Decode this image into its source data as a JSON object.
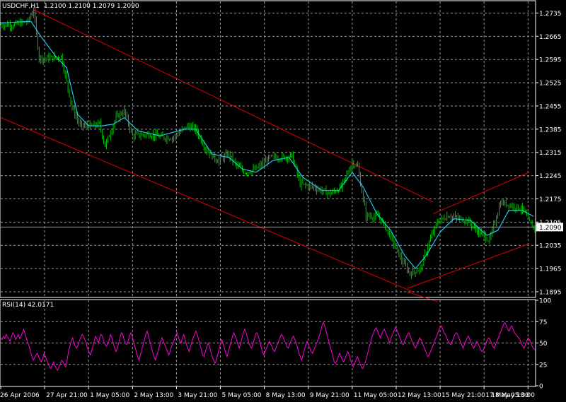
{
  "colors": {
    "background": "#000000",
    "axis": "#ffffff",
    "grid": "#9a9a9a",
    "candle": "#00c000",
    "ma": "#22c7e6",
    "channel": "#e00000",
    "rsi": "#ff00d8",
    "price_line": "#9aa0a6"
  },
  "header": {
    "symbol": "USDCHF,H1",
    "ohlc": "1.2100 1.2100 1.2079 1.2090"
  },
  "rsi_header": "RSI(14) 42.0171",
  "current_price_label": "1.2090",
  "chart_data": [
    {
      "type": "candlestick",
      "title": "USDCHF,H1",
      "ylim": [
        1.188,
        1.277
      ],
      "y_ticks": [
        "1.2735",
        "1.2665",
        "1.2595",
        "1.2525",
        "1.2455",
        "1.2385",
        "1.2315",
        "1.2245",
        "1.2175",
        "1.2105",
        "1.2035",
        "1.1965",
        "1.1895"
      ],
      "y_tick_values": [
        1.2735,
        1.2665,
        1.2595,
        1.2525,
        1.2455,
        1.2385,
        1.2315,
        1.2245,
        1.2175,
        1.2105,
        1.2035,
        1.1965,
        1.1895
      ],
      "x_ticks": [
        "26 Apr 2006",
        "27 Apr 21:00",
        "1 May 05:00",
        "2 May 13:00",
        "3 May 21:00",
        "5 May 05:00",
        "8 May 13:00",
        "9 May 21:00",
        "11 May 05:00",
        "12 May 13:00",
        "15 May 21:00",
        "17 May 05:00",
        "18 May 13:00"
      ],
      "x_tick_bars": [
        0,
        32,
        64,
        96,
        128,
        160,
        192,
        224,
        256,
        288,
        320,
        352,
        384
      ],
      "bar_count": 390,
      "current_price": 1.209,
      "close_path": [
        [
          0,
          1.27
        ],
        [
          10,
          1.27
        ],
        [
          20,
          1.271
        ],
        [
          24,
          1.2745
        ],
        [
          28,
          1.26
        ],
        [
          38,
          1.26
        ],
        [
          44,
          1.2605
        ],
        [
          52,
          1.245
        ],
        [
          58,
          1.2395
        ],
        [
          66,
          1.2395
        ],
        [
          72,
          1.24
        ],
        [
          76,
          1.2335
        ],
        [
          84,
          1.242
        ],
        [
          90,
          1.244
        ],
        [
          96,
          1.2365
        ],
        [
          108,
          1.237
        ],
        [
          118,
          1.236
        ],
        [
          126,
          1.236
        ],
        [
          136,
          1.2395
        ],
        [
          142,
          1.2385
        ],
        [
          150,
          1.232
        ],
        [
          158,
          1.229
        ],
        [
          166,
          1.231
        ],
        [
          172,
          1.2275
        ],
        [
          178,
          1.2255
        ],
        [
          186,
          1.2265
        ],
        [
          196,
          1.23
        ],
        [
          206,
          1.23
        ],
        [
          212,
          1.2305
        ],
        [
          218,
          1.222
        ],
        [
          228,
          1.221
        ],
        [
          240,
          1.219
        ],
        [
          248,
          1.221
        ],
        [
          256,
          1.2285
        ],
        [
          260,
          1.227
        ],
        [
          266,
          1.2125
        ],
        [
          276,
          1.212
        ],
        [
          284,
          1.206
        ],
        [
          292,
          1.199
        ],
        [
          298,
          1.195
        ],
        [
          306,
          1.1965
        ],
        [
          312,
          1.2045
        ],
        [
          318,
          1.2105
        ],
        [
          326,
          1.2125
        ],
        [
          334,
          1.2115
        ],
        [
          340,
          1.211
        ],
        [
          348,
          1.2075
        ],
        [
          356,
          1.205
        ],
        [
          364,
          1.2165
        ],
        [
          372,
          1.2155
        ],
        [
          380,
          1.2145
        ],
        [
          386,
          1.2095
        ],
        [
          389,
          1.209
        ]
      ],
      "ma_path": [
        [
          0,
          1.2705
        ],
        [
          22,
          1.271
        ],
        [
          30,
          1.266
        ],
        [
          40,
          1.2605
        ],
        [
          48,
          1.257
        ],
        [
          56,
          1.243
        ],
        [
          64,
          1.2395
        ],
        [
          74,
          1.2395
        ],
        [
          82,
          1.24
        ],
        [
          90,
          1.242
        ],
        [
          100,
          1.238
        ],
        [
          116,
          1.2365
        ],
        [
          134,
          1.2385
        ],
        [
          142,
          1.2385
        ],
        [
          154,
          1.231
        ],
        [
          166,
          1.23
        ],
        [
          176,
          1.2265
        ],
        [
          186,
          1.2255
        ],
        [
          198,
          1.229
        ],
        [
          210,
          1.23
        ],
        [
          220,
          1.224
        ],
        [
          234,
          1.22
        ],
        [
          246,
          1.22
        ],
        [
          256,
          1.2255
        ],
        [
          264,
          1.221
        ],
        [
          274,
          1.213
        ],
        [
          284,
          1.208
        ],
        [
          294,
          1.2005
        ],
        [
          302,
          1.1965
        ],
        [
          310,
          1.2005
        ],
        [
          320,
          1.2075
        ],
        [
          330,
          1.2115
        ],
        [
          342,
          1.211
        ],
        [
          354,
          1.2065
        ],
        [
          362,
          1.208
        ],
        [
          370,
          1.214
        ],
        [
          380,
          1.214
        ],
        [
          389,
          1.212
        ]
      ],
      "channel_lines": [
        [
          [
            24,
            1.2745
          ],
          [
            315,
            1.2165
          ]
        ],
        [
          [
            0,
            1.242
          ],
          [
            300,
            1.1895
          ]
        ],
        [
          [
            296,
            1.1905
          ],
          [
            385,
            1.204
          ]
        ],
        [
          [
            315,
            1.213
          ],
          [
            385,
            1.2255
          ]
        ],
        [
          [
            296,
            1.1895
          ],
          [
            318,
            1.1865
          ]
        ]
      ]
    },
    {
      "type": "line",
      "title": "RSI(14) 42.0171",
      "ylim": [
        0,
        100
      ],
      "y_ticks": [
        "100",
        "75",
        "50",
        "25",
        "0"
      ],
      "y_tick_values": [
        100,
        75,
        50,
        25,
        0
      ],
      "values": [
        56,
        54,
        58,
        55,
        60,
        57,
        55,
        52,
        58,
        62,
        59,
        54,
        57,
        60,
        55,
        58,
        62,
        66,
        60,
        55,
        50,
        46,
        40,
        34,
        30,
        33,
        36,
        38,
        34,
        30,
        28,
        32,
        38,
        34,
        30,
        26,
        22,
        20,
        24,
        28,
        24,
        20,
        18,
        22,
        26,
        30,
        28,
        24,
        22,
        30,
        40,
        46,
        52,
        56,
        50,
        46,
        44,
        48,
        52,
        56,
        60,
        58,
        54,
        50,
        44,
        40,
        36,
        40,
        46,
        52,
        58,
        54,
        50,
        56,
        60,
        58,
        52,
        48,
        46,
        50,
        54,
        60,
        56,
        50,
        44,
        40,
        44,
        50,
        56,
        62,
        60,
        54,
        50,
        48,
        52,
        58,
        62,
        58,
        52,
        46,
        40,
        34,
        30,
        36,
        42,
        48,
        54,
        60,
        64,
        58,
        52,
        46,
        40,
        34,
        30,
        36,
        40,
        46,
        52,
        56,
        52,
        48,
        44,
        40,
        36,
        40,
        46,
        50,
        54,
        58,
        62,
        58,
        52,
        50,
        56,
        60,
        54,
        48,
        44,
        40,
        46,
        52,
        56,
        60,
        64,
        60,
        54,
        48,
        42,
        36,
        34,
        40,
        46,
        50,
        46,
        40,
        34,
        30,
        26,
        30,
        36,
        42,
        48,
        54,
        50,
        44,
        38,
        34,
        40,
        46,
        52,
        58,
        62,
        58,
        54,
        48,
        44,
        50,
        56,
        62,
        66,
        62,
        56,
        50,
        46,
        44,
        48,
        54,
        60,
        62,
        58,
        52,
        46,
        40,
        36,
        40,
        44,
        48,
        52,
        50,
        46,
        42,
        40,
        44,
        48,
        52,
        56,
        60,
        58,
        54,
        50,
        46,
        44,
        48,
        52,
        56,
        58,
        54,
        50,
        44,
        38,
        34,
        30,
        36,
        42,
        48,
        52,
        48,
        44,
        40,
        38,
        42,
        46,
        50,
        54,
        58,
        64,
        70,
        74,
        70,
        64,
        58,
        52,
        46,
        40,
        34,
        28,
        26,
        30,
        34,
        38,
        34,
        30,
        28,
        32,
        36,
        40,
        36,
        30,
        26,
        22,
        26,
        30,
        34,
        30,
        26,
        22,
        20,
        24,
        28,
        34,
        40,
        46,
        52,
        58,
        62,
        66,
        68,
        64,
        60,
        56,
        60,
        64,
        66,
        62,
        58,
        54,
        50,
        56,
        60,
        64,
        68,
        66,
        62,
        58,
        54,
        50,
        48,
        52,
        56,
        60,
        62,
        58,
        54,
        50,
        46,
        44,
        48,
        52,
        56,
        54,
        50,
        46,
        42,
        38,
        34,
        36,
        40,
        44,
        48,
        52,
        56,
        60,
        64,
        68,
        70,
        66,
        62,
        60,
        56,
        52,
        50,
        48,
        52,
        56,
        60,
        62,
        60,
        56,
        52,
        48,
        44,
        48,
        52,
        56,
        58,
        54,
        50,
        46,
        44,
        48,
        52,
        50,
        46,
        42,
        40,
        42,
        46,
        50,
        54,
        56,
        54,
        50,
        46,
        44,
        48,
        52,
        56,
        60,
        64,
        68,
        72,
        74,
        70,
        66,
        64,
        68,
        70,
        66,
        62,
        60,
        58,
        56,
        54,
        50,
        46,
        44,
        48,
        52,
        56,
        54,
        50,
        46,
        44,
        42
      ]
    }
  ]
}
